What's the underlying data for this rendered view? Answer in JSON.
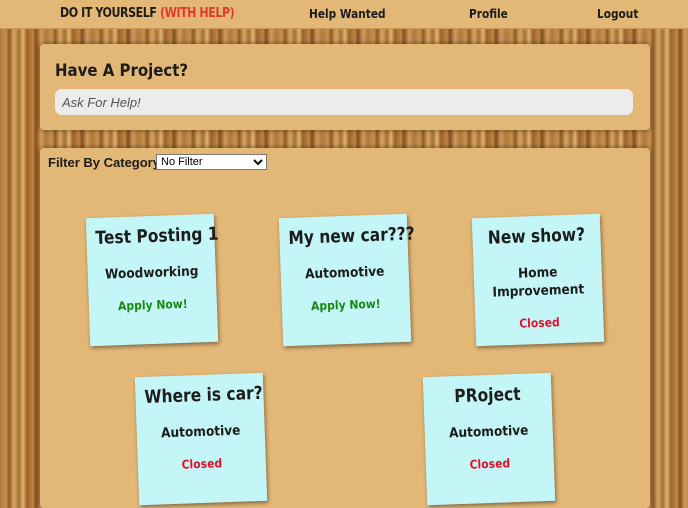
{
  "header": {
    "brand_main": "DO IT YOURSELF",
    "brand_accent": "(WITH HELP)",
    "nav": {
      "help_wanted": "Help Wanted",
      "profile": "Profile",
      "logout": "Logout"
    }
  },
  "ask": {
    "title": "Have A Project?",
    "placeholder": "Ask For Help!"
  },
  "filter": {
    "label": "Filter By Category",
    "selected": "No Filter"
  },
  "colors": {
    "open": "#168a10",
    "closed": "#e4102a",
    "note": "#c5f6f7",
    "panel": "#e3b877"
  },
  "posts": [
    {
      "title": "Test Posting 1",
      "category": "Woodworking",
      "status": "Apply Now!"
    },
    {
      "title": "My new car???",
      "category": "Automotive",
      "status": "Apply Now!"
    },
    {
      "title": "New show?",
      "category": "Home Improvement",
      "status": "Closed"
    },
    {
      "title": "Where is car?",
      "category": "Automotive",
      "status": "Closed"
    },
    {
      "title": "PRoject",
      "category": "Automotive",
      "status": "Closed"
    }
  ]
}
